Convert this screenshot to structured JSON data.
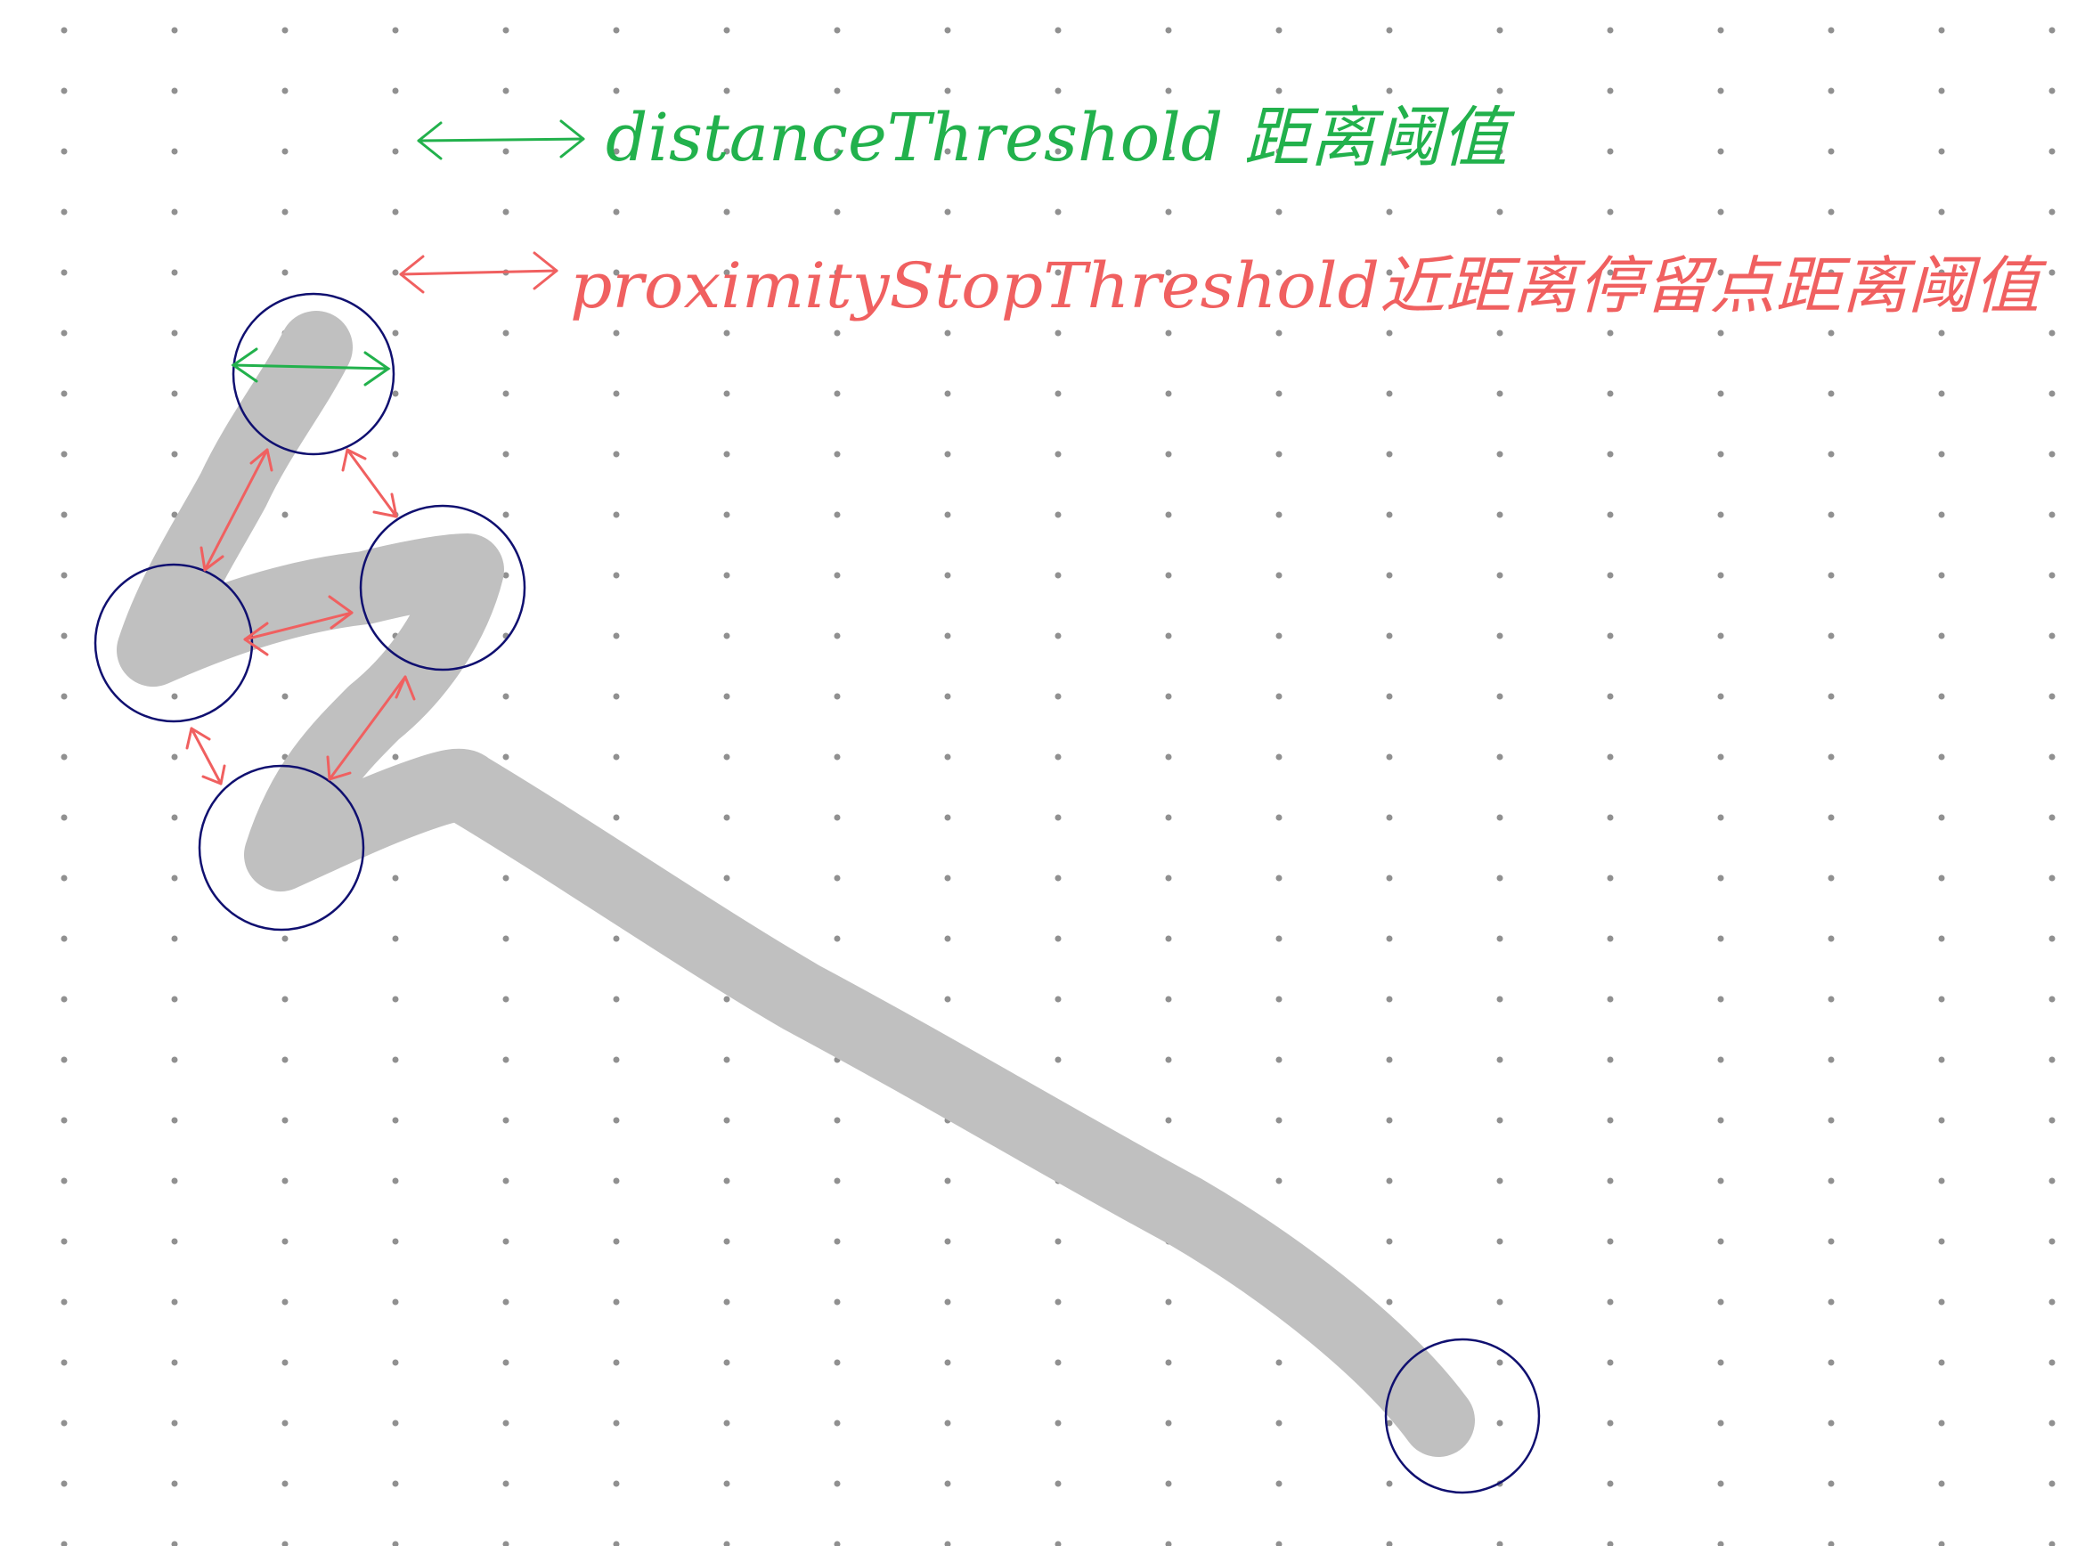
{
  "legend": {
    "distance": {
      "label": "distanceThreshold 距离阈值",
      "color": "#22b14c"
    },
    "proximity": {
      "label": "proximityStopThreshold近距离停留点距离阈值",
      "color": "#f06060"
    }
  },
  "colors": {
    "stroke": "#c0c0c0",
    "circle": "#101070",
    "grid_dot": "#909090",
    "background": "#ffffff"
  }
}
